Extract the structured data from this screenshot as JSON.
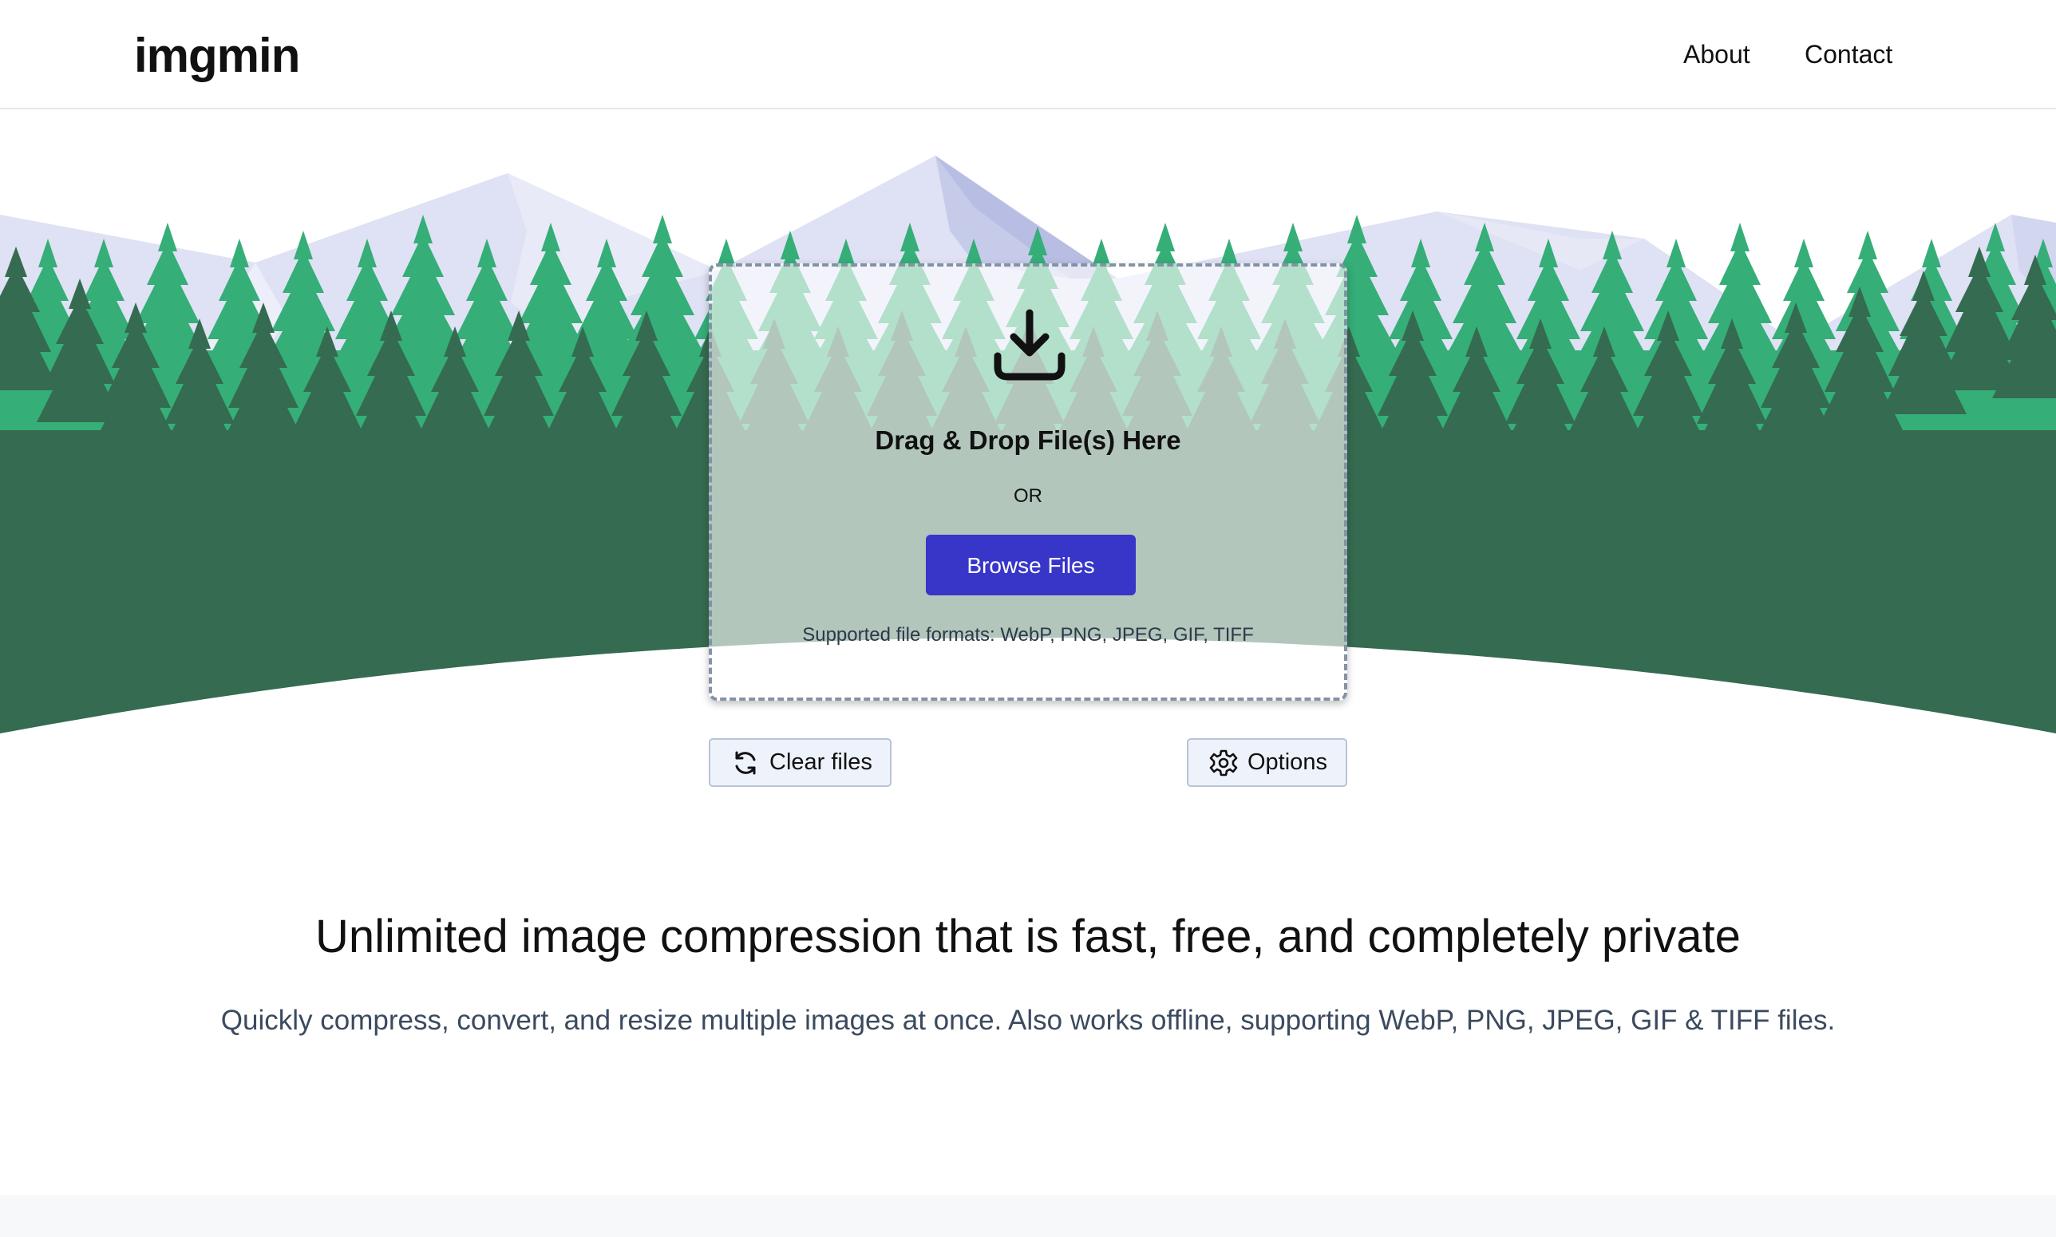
{
  "header": {
    "logo": "imgmin",
    "nav": [
      {
        "label": "About"
      },
      {
        "label": "Contact"
      }
    ]
  },
  "dropzone": {
    "icon": "download-icon",
    "title": "Drag & Drop File(s) Here",
    "or": "OR",
    "browse_label": "Browse Files",
    "formats": "Supported file formats: WebP, PNG, JPEG, GIF, TIFF"
  },
  "actions": {
    "clear_label": "Clear files",
    "clear_icon": "refresh-icon",
    "options_label": "Options",
    "options_icon": "gear-icon"
  },
  "content": {
    "headline": "Unlimited image compression that is fast, free, and completely private",
    "subline": "Quickly compress, convert, and resize multiple images at once. Also works offline, supporting WebP, PNG, JPEG, GIF & TIFF files."
  },
  "colors": {
    "accent": "#3835c9",
    "forest_dark": "#356b50",
    "forest_light": "#33b07a",
    "mountain": "#dcdff2",
    "mountain_shade": "#b9bfe4"
  }
}
